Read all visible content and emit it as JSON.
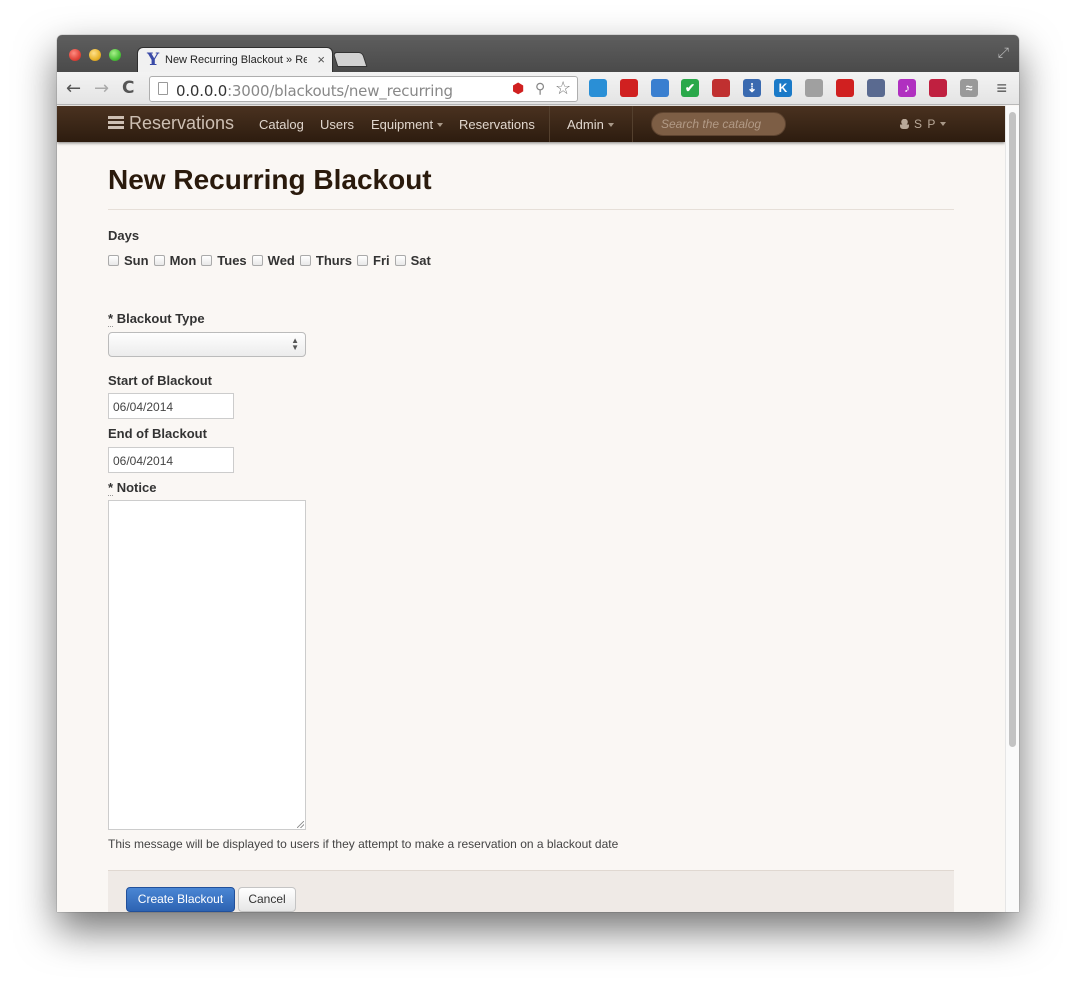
{
  "browser": {
    "tab_title": "New Recurring Blackout » Re",
    "tab_favicon": "Y",
    "close_glyph": "×",
    "url_host": "0.0.0.0",
    "url_path": ":3000/blackouts/new_recurring",
    "back_glyph": "←",
    "forward_glyph": "→",
    "reload_glyph": "C",
    "menu_glyph": "≡",
    "extensions": [
      {
        "icon": "circle-logo-icon",
        "color": "#2a8fd6",
        "text": ""
      },
      {
        "icon": "red-sofa-icon",
        "color": "#d02020",
        "text": ""
      },
      {
        "icon": "calendar-icon",
        "color": "#3a7fd0",
        "text": ""
      },
      {
        "icon": "check-icon",
        "color": "#2aa84a",
        "text": "✔"
      },
      {
        "icon": "calendar-13-icon",
        "color": "#c03030",
        "text": ""
      },
      {
        "icon": "download-icon",
        "color": "#3a6ab0",
        "text": "⇣"
      },
      {
        "icon": "k-icon",
        "color": "#1a7ac8",
        "text": "K"
      },
      {
        "icon": "book-icon",
        "color": "#a0a0a0",
        "text": ""
      },
      {
        "icon": "stop-icon",
        "color": "#d02020",
        "text": ""
      },
      {
        "icon": "window-12-icon",
        "color": "#5a6a90",
        "text": ""
      },
      {
        "icon": "music-note-icon",
        "color": "#b030c0",
        "text": "♪"
      },
      {
        "icon": "tv-icon",
        "color": "#c02040",
        "text": ""
      },
      {
        "icon": "wave-icon",
        "color": "#999999",
        "text": "≈"
      }
    ]
  },
  "nav": {
    "brand": "Reservations",
    "items": {
      "catalog": "Catalog",
      "users": "Users",
      "equipment": "Equipment",
      "reservations": "Reservations",
      "admin": "Admin"
    },
    "search_placeholder": "Search the catalog",
    "user_initials": "S P"
  },
  "page": {
    "title": "New Recurring Blackout",
    "days_label": "Days",
    "days": [
      "Sun",
      "Mon",
      "Tues",
      "Wed",
      "Thurs",
      "Fri",
      "Sat"
    ],
    "required_mark": "*",
    "blackout_type_label": "Blackout Type",
    "start_label": "Start of Blackout",
    "start_value": "06/04/2014",
    "end_label": "End of Blackout",
    "end_value": "06/04/2014",
    "notice_label": "Notice",
    "notice_help": "This message will be displayed to users if they attempt to make a reservation on a blackout date",
    "create_button": "Create Blackout",
    "cancel_button": "Cancel"
  },
  "colors": {
    "nav_bg": "#3a2616",
    "primary_button": "#2d63b2",
    "page_bg": "#faf7f4"
  }
}
